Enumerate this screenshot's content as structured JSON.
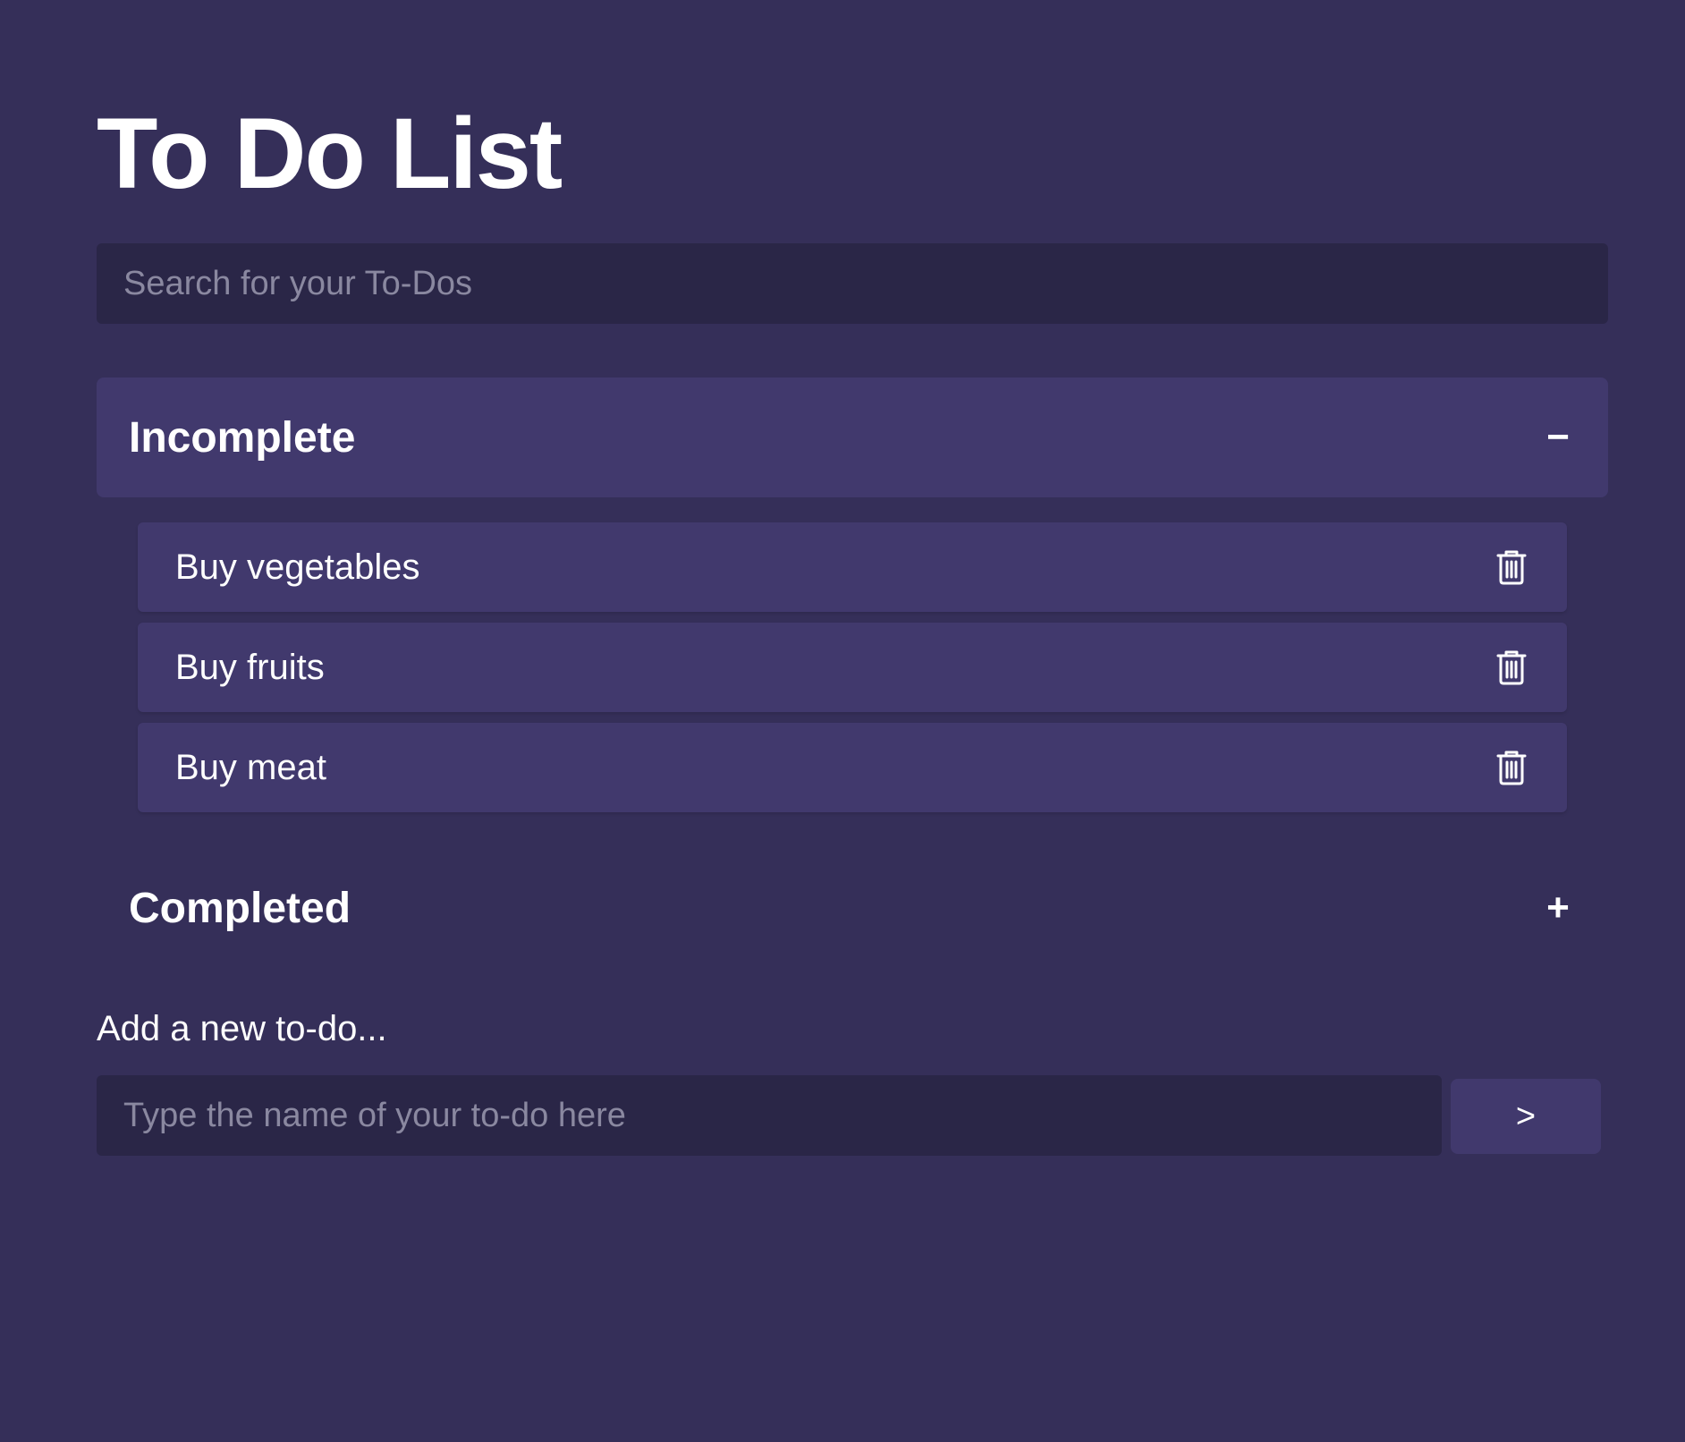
{
  "page": {
    "title": "To Do List",
    "background_color": "#352f59"
  },
  "search": {
    "placeholder": "Search for your To-Dos",
    "value": ""
  },
  "sections": {
    "incomplete": {
      "title": "Incomplete",
      "toggle_symbol": "−",
      "expanded": true,
      "items": [
        {
          "label": "Buy vegetables",
          "icon": "trash-icon"
        },
        {
          "label": "Buy fruits",
          "icon": "trash-icon"
        },
        {
          "label": "Buy meat",
          "icon": "trash-icon"
        }
      ]
    },
    "completed": {
      "title": "Completed",
      "toggle_symbol": "+",
      "expanded": false
    }
  },
  "new_todo": {
    "label": "Add a new to-do...",
    "placeholder": "Type the name of your to-do here",
    "value": "",
    "submit_label": ">"
  },
  "colors": {
    "card": "#41396d",
    "input_bg": "#2a2647",
    "text": "#ffffff",
    "placeholder": "#8a88a0"
  }
}
